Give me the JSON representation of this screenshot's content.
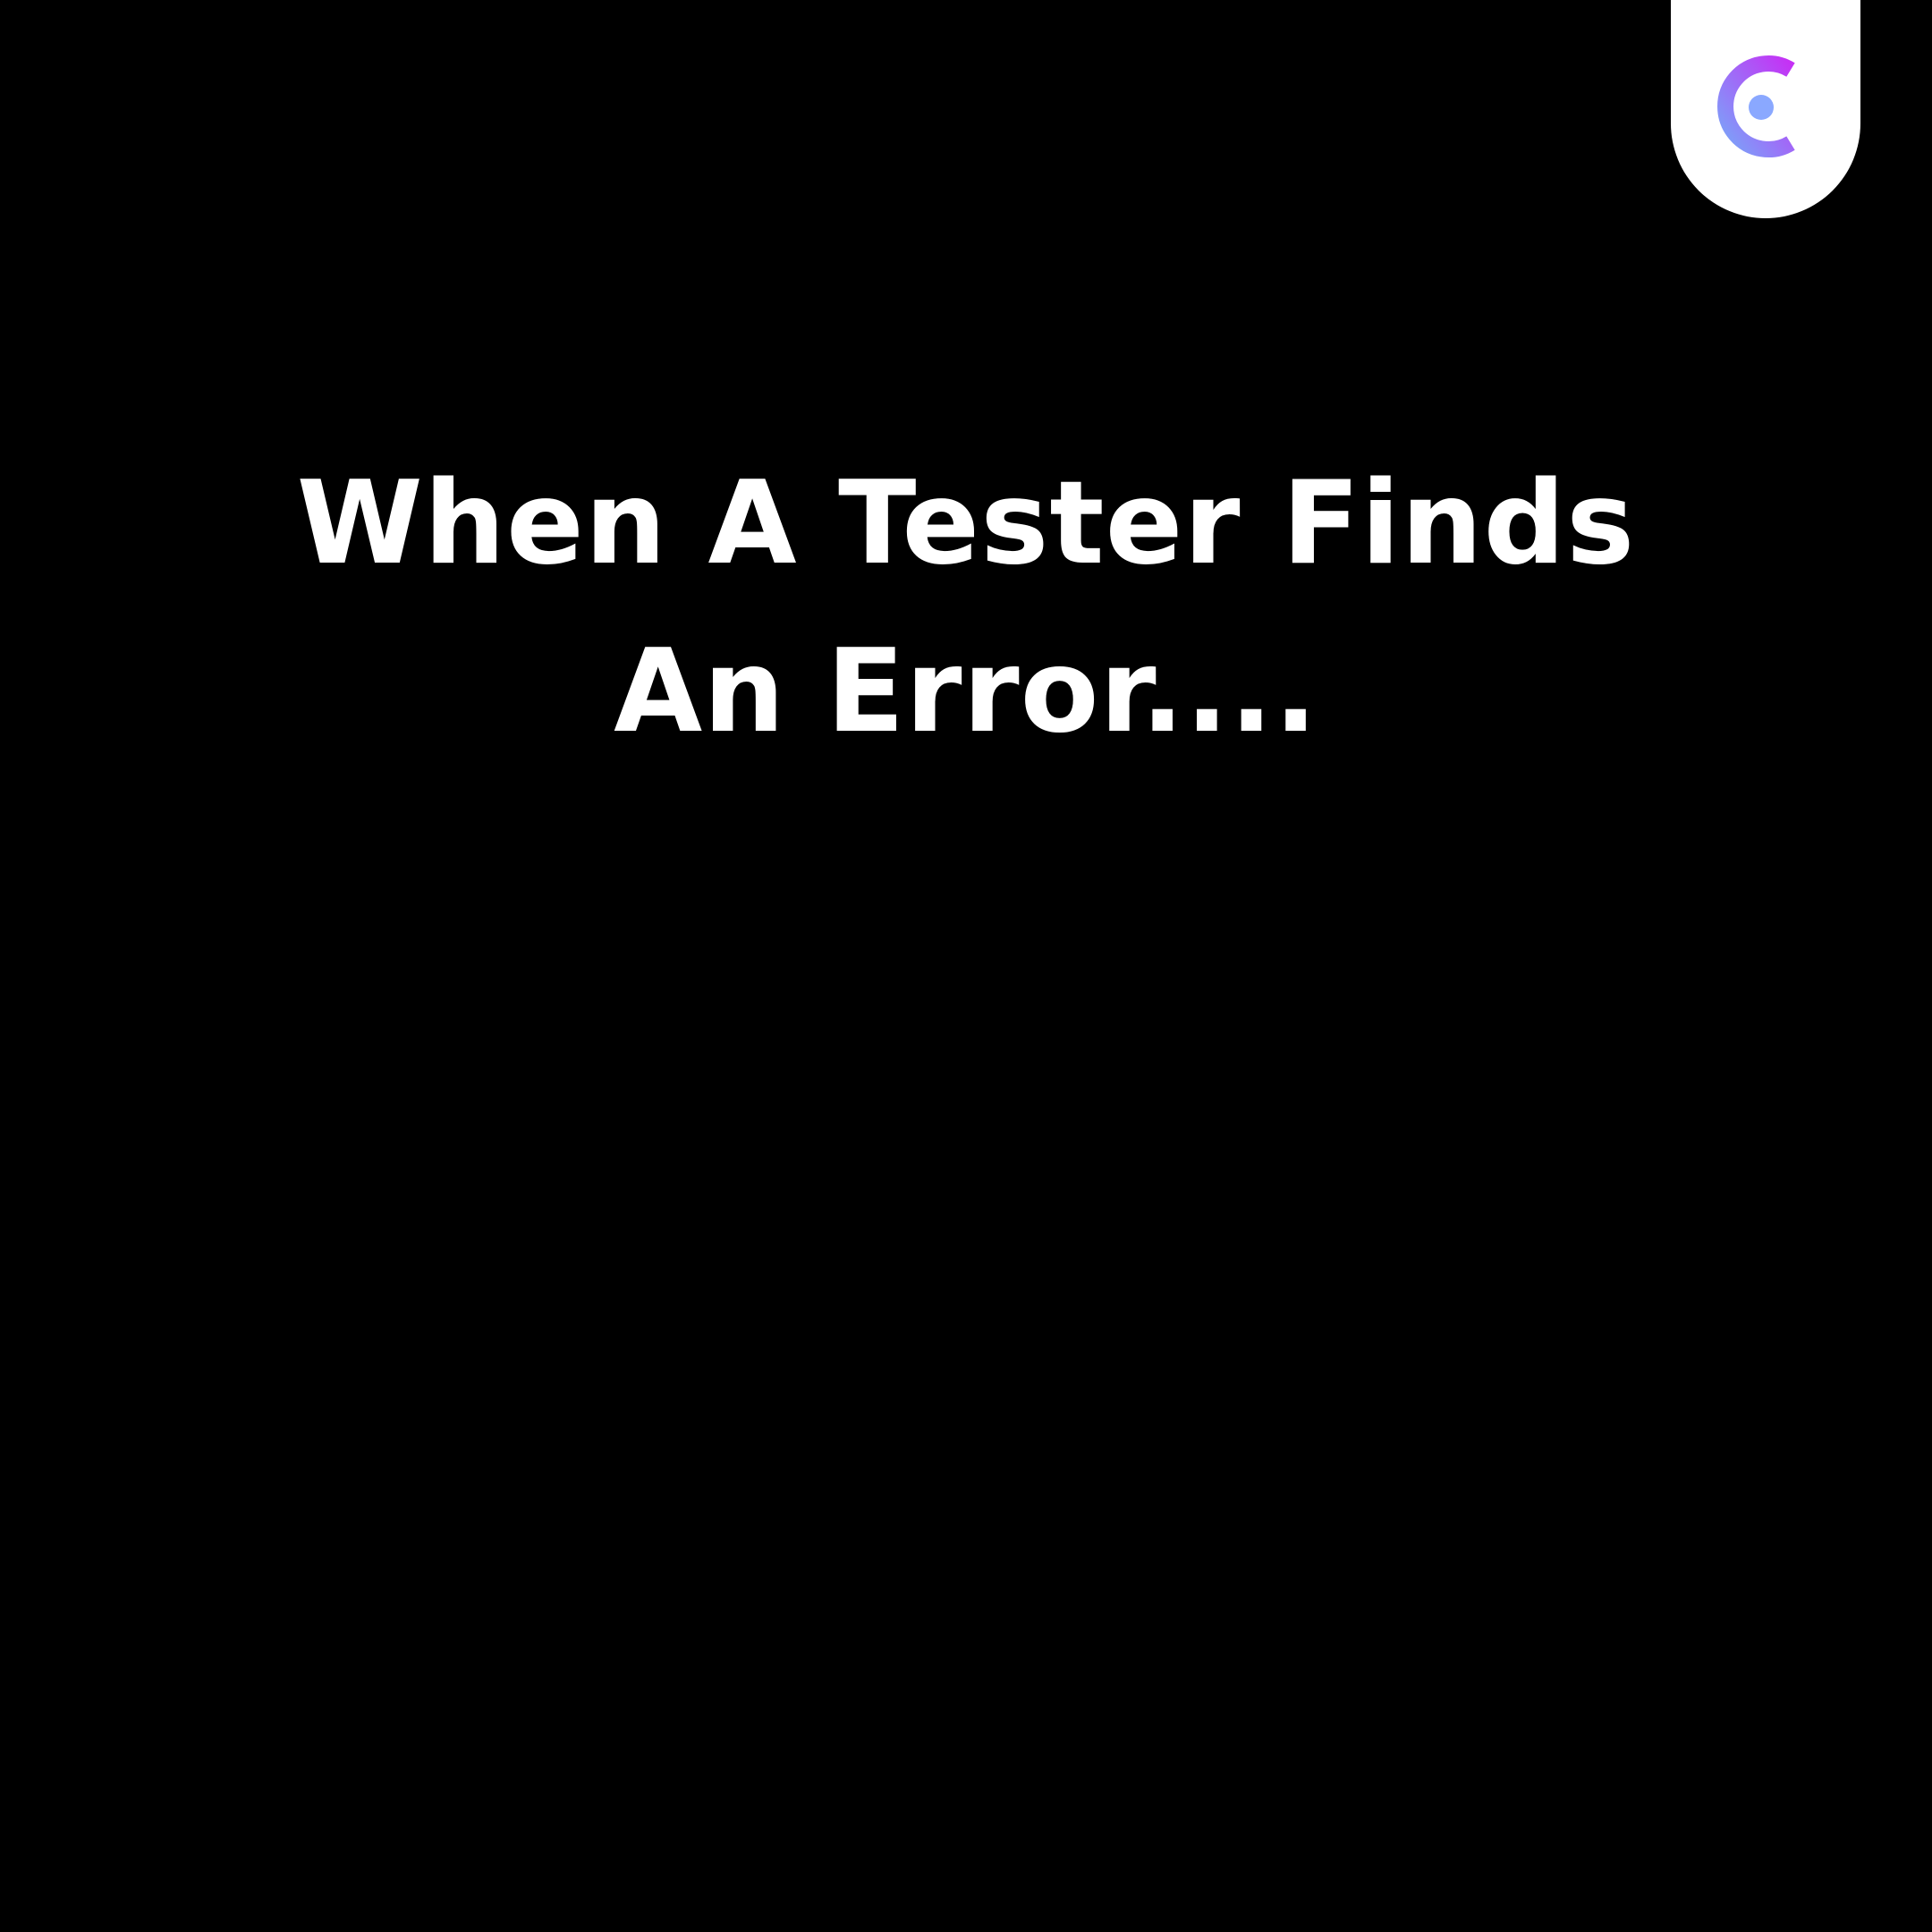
{
  "headline": {
    "line1": "When A Tester Finds",
    "line2": "An Error...."
  },
  "logo": {
    "icon": "c-logo-icon",
    "gradient_start": "#7aa5f9",
    "gradient_end": "#c531f5",
    "dot_color": "#8aa8ff"
  },
  "colors": {
    "background": "#000000",
    "text": "#ffffff",
    "tab": "#ffffff"
  }
}
